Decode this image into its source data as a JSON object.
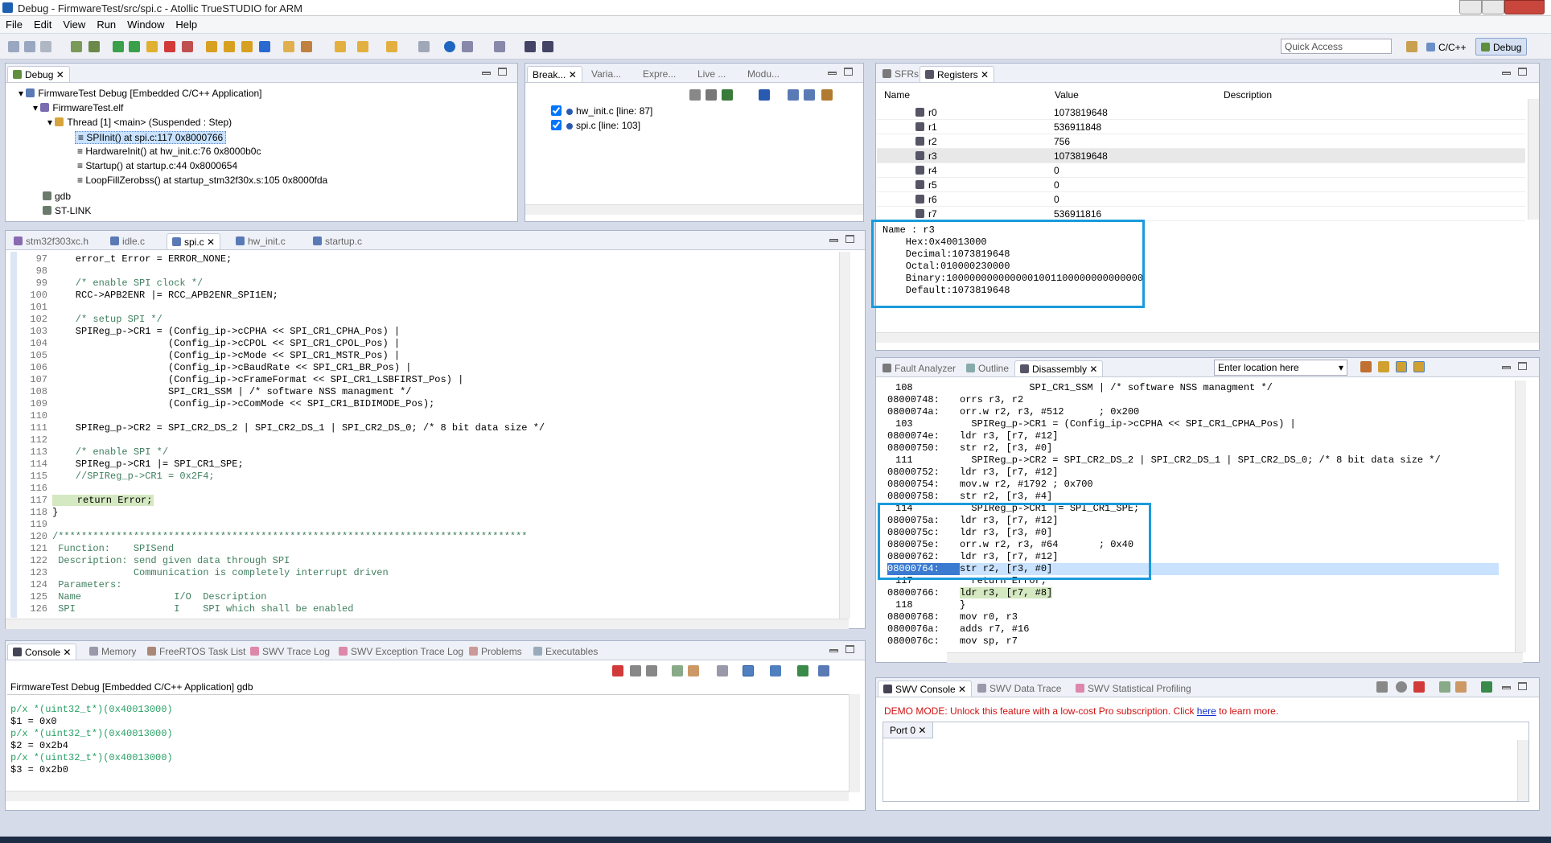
{
  "window": {
    "title": "Debug - FirmwareTest/src/spi.c - Atollic TrueSTUDIO for ARM"
  },
  "menu": [
    "File",
    "Edit",
    "View",
    "Run",
    "Window",
    "Help"
  ],
  "quick_access": "Quick Access",
  "perspectives": {
    "cpp": "C/C++",
    "debug": "Debug"
  },
  "debug_view": {
    "tab": "Debug",
    "items": [
      "FirmwareTest Debug [Embedded C/C++ Application]",
      "FirmwareTest.elf",
      "Thread [1] <main> (Suspended : Step)",
      "SPIInit() at spi.c:117 0x8000766",
      "HardwareInit() at hw_init.c:76 0x8000b0c",
      "Startup() at startup.c:44 0x8000654",
      "LoopFillZerobss() at startup_stm32f30x.s:105 0x8000fda",
      "gdb",
      "ST-LINK"
    ]
  },
  "breakpoints": {
    "tabs": [
      "Break...",
      "Varia...",
      "Expre...",
      "Live ...",
      "Modu..."
    ],
    "items": [
      "hw_init.c [line: 87]",
      "spi.c [line: 103]"
    ]
  },
  "registers": {
    "tabs": [
      "SFRs",
      "Registers"
    ],
    "headers": [
      "Name",
      "Value",
      "Description"
    ],
    "rows": [
      [
        "r0",
        "1073819648"
      ],
      [
        "r1",
        "536911848"
      ],
      [
        "r2",
        "756"
      ],
      [
        "r3",
        "1073819648"
      ],
      [
        "r4",
        "0"
      ],
      [
        "r5",
        "0"
      ],
      [
        "r6",
        "0"
      ],
      [
        "r7",
        "536911816"
      ]
    ],
    "detail": [
      "Name : r3",
      "    Hex:0x40013000",
      "    Decimal:1073819648",
      "    Octal:010000230000",
      "    Binary:1000000000000001001100000000000000",
      "    Default:1073819648"
    ]
  },
  "editor": {
    "tabs": [
      "stm32f303xc.h",
      "idle.c",
      "spi.c",
      "hw_init.c",
      "startup.c"
    ],
    "lines": [
      [
        "97",
        "    error_t Error = ERROR_NONE;"
      ],
      [
        "98",
        ""
      ],
      [
        "99",
        "    /* enable SPI clock */"
      ],
      [
        "100",
        "    RCC->APB2ENR |= RCC_APB2ENR_SPI1EN;"
      ],
      [
        "101",
        ""
      ],
      [
        "102",
        "    /* setup SPI */"
      ],
      [
        "103",
        "    SPIReg_p->CR1 = (Config_ip->cCPHA << SPI_CR1_CPHA_Pos) |"
      ],
      [
        "104",
        "                    (Config_ip->cCPOL << SPI_CR1_CPOL_Pos) |"
      ],
      [
        "105",
        "                    (Config_ip->cMode << SPI_CR1_MSTR_Pos) |"
      ],
      [
        "106",
        "                    (Config_ip->cBaudRate << SPI_CR1_BR_Pos) |"
      ],
      [
        "107",
        "                    (Config_ip->cFrameFormat << SPI_CR1_LSBFIRST_Pos) |"
      ],
      [
        "108",
        "                    SPI_CR1_SSM | /* software NSS managment */"
      ],
      [
        "109",
        "                    (Config_ip->cComMode << SPI_CR1_BIDIMODE_Pos);"
      ],
      [
        "110",
        ""
      ],
      [
        "111",
        "    SPIReg_p->CR2 = SPI_CR2_DS_2 | SPI_CR2_DS_1 | SPI_CR2_DS_0; /* 8 bit data size */"
      ],
      [
        "112",
        ""
      ],
      [
        "113",
        "    /* enable SPI */"
      ],
      [
        "114",
        "    SPIReg_p->CR1 |= SPI_CR1_SPE;"
      ],
      [
        "115",
        "    //SPIReg_p->CR1 = 0x2F4;"
      ],
      [
        "116",
        ""
      ],
      [
        "117",
        "    return Error;"
      ],
      [
        "118",
        "}"
      ],
      [
        "119",
        ""
      ],
      [
        "120",
        "/*********************************************************************************"
      ],
      [
        "121",
        " Function:    SPISend"
      ],
      [
        "122",
        " Description: send given data through SPI"
      ],
      [
        "123",
        "              Communication is completely interrupt driven"
      ],
      [
        "124",
        " Parameters:"
      ],
      [
        "125",
        " Name                I/O  Description"
      ],
      [
        "126",
        " SPI                 I    SPI which shall be enabled"
      ]
    ]
  },
  "disassembly": {
    "tabs": [
      "Fault Analyzer",
      "Outline",
      "Disassembly"
    ],
    "location_placeholder": "Enter location here",
    "lines": [
      [
        "108",
        "",
        "            SPI_CR1_SSM | /* software NSS managment */"
      ],
      [
        "08000748:",
        "",
        "orrs r3, r2"
      ],
      [
        "0800074a:",
        "",
        "orr.w r2, r3, #512      ; 0x200"
      ],
      [
        "103",
        "",
        "  SPIReg_p->CR1 = (Config_ip->cCPHA << SPI_CR1_CPHA_Pos) |"
      ],
      [
        "0800074e:",
        "",
        "ldr r3, [r7, #12]"
      ],
      [
        "08000750:",
        "",
        "str r2, [r3, #0]"
      ],
      [
        "111",
        "",
        "  SPIReg_p->CR2 = SPI_CR2_DS_2 | SPI_CR2_DS_1 | SPI_CR2_DS_0; /* 8 bit data size */"
      ],
      [
        "08000752:",
        "",
        "ldr r3, [r7, #12]"
      ],
      [
        "08000754:",
        "",
        "mov.w r2, #1792 ; 0x700"
      ],
      [
        "08000758:",
        "",
        "str r2, [r3, #4]"
      ],
      [
        "114",
        "",
        "  SPIReg_p->CR1 |= SPI_CR1_SPE;"
      ],
      [
        "0800075a:",
        "",
        "ldr r3, [r7, #12]"
      ],
      [
        "0800075c:",
        "",
        "ldr r3, [r3, #0]"
      ],
      [
        "0800075e:",
        "",
        "orr.w r2, r3, #64       ; 0x40"
      ],
      [
        "08000762:",
        "",
        "ldr r3, [r7, #12]"
      ],
      [
        "08000764:",
        "",
        "str r2, [r3, #0]"
      ],
      [
        "117",
        "",
        "  return Error;"
      ],
      [
        "08000766:",
        "",
        "ldr r3, [r7, #8]"
      ],
      [
        "118",
        "",
        "}"
      ],
      [
        "08000768:",
        "",
        "mov r0, r3"
      ],
      [
        "0800076a:",
        "",
        "adds r7, #16"
      ],
      [
        "0800076c:",
        "",
        "mov sp, r7"
      ]
    ]
  },
  "console": {
    "tabs": [
      "Console",
      "Memory",
      "FreeRTOS Task List",
      "SWV Trace Log",
      "SWV Exception Trace Log",
      "Problems",
      "Executables"
    ],
    "title": "FirmwareTest Debug [Embedded C/C++ Application] gdb",
    "lines": [
      [
        "p/x *(uint32_t*)(0x40013000)",
        "cmd"
      ],
      [
        "$1 = 0x0",
        "out"
      ],
      [
        "p/x *(uint32_t*)(0x40013000)",
        "cmd"
      ],
      [
        "$2 = 0x2b4",
        "out"
      ],
      [
        "p/x *(uint32_t*)(0x40013000)",
        "cmd"
      ],
      [
        "$3 = 0x2b0",
        "out"
      ]
    ]
  },
  "swv": {
    "tabs": [
      "SWV Console",
      "SWV Data Trace",
      "SWV Statistical Profiling"
    ],
    "demo_text": "DEMO MODE: Unlock this feature with a low-cost Pro subscription. Click ",
    "demo_link": "here",
    "demo_tail": " to learn more.",
    "port": "Port 0"
  }
}
